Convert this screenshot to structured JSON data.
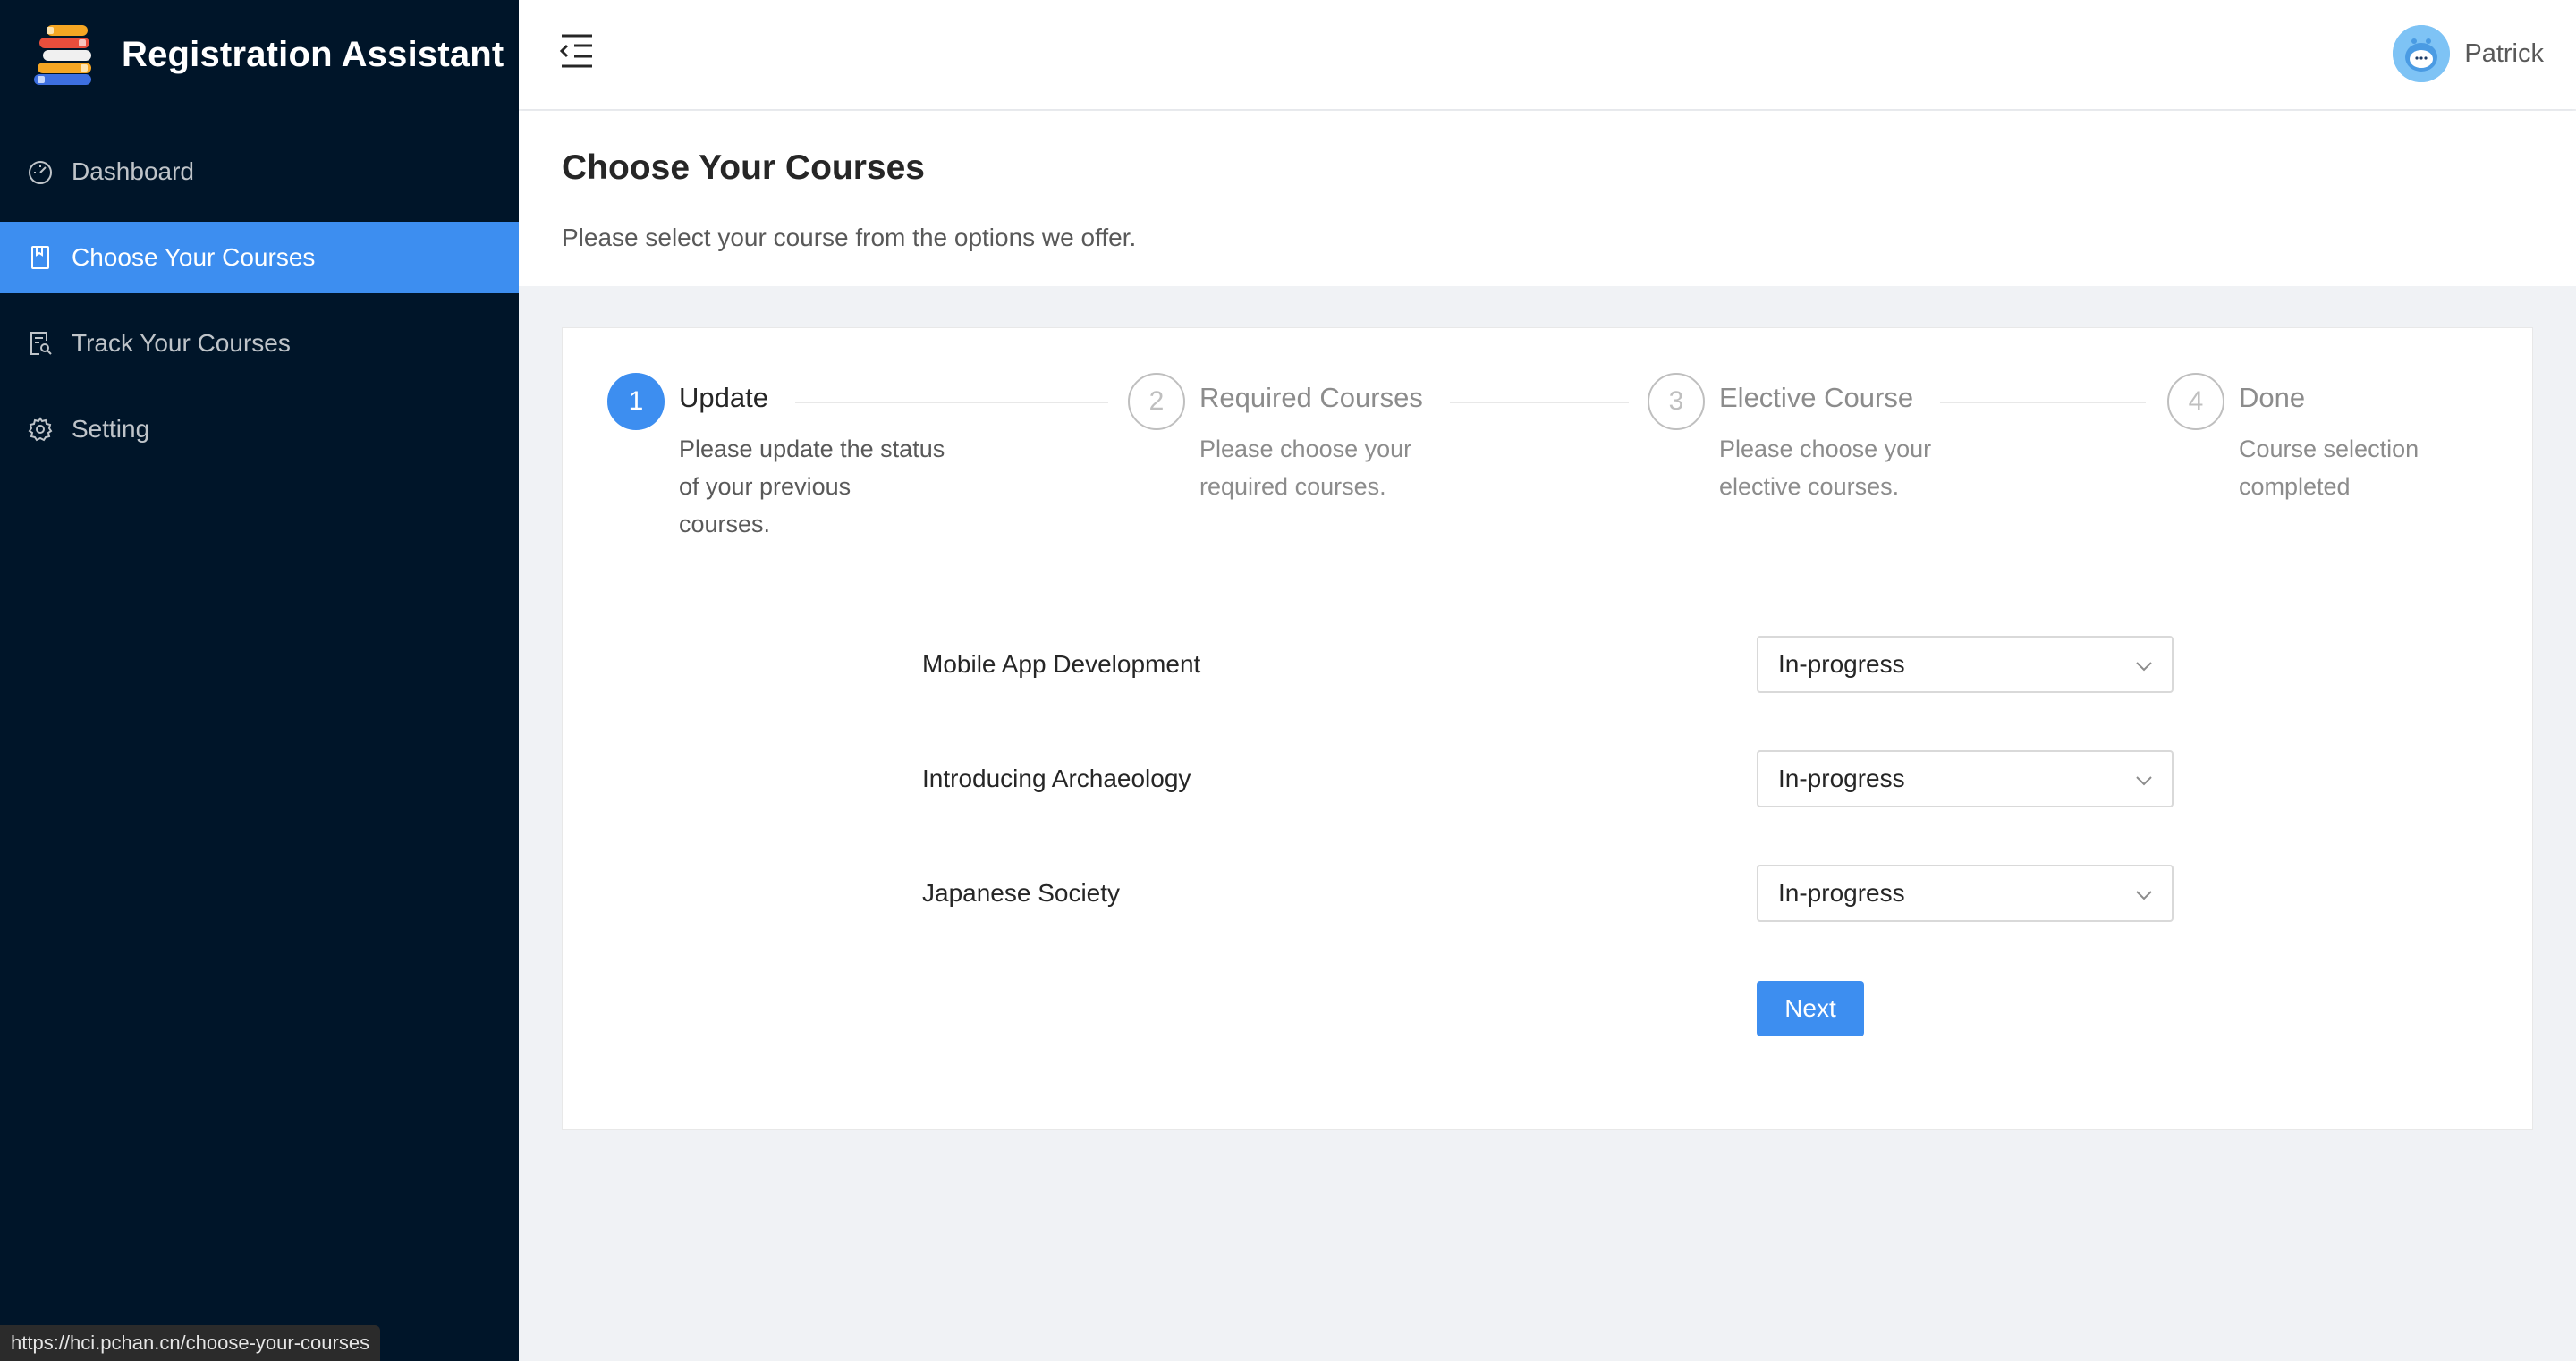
{
  "app": {
    "title": "Registration Assistant",
    "accent_color": "#3d8ef0",
    "sidebar_color": "#001529"
  },
  "sidebar": {
    "items": [
      {
        "label": "Dashboard",
        "icon": "dashboard-icon",
        "active": false
      },
      {
        "label": "Choose Your Courses",
        "icon": "book-icon",
        "active": true
      },
      {
        "label": "Track Your Courses",
        "icon": "file-search-icon",
        "active": false
      },
      {
        "label": "Setting",
        "icon": "gear-icon",
        "active": false
      }
    ]
  },
  "header": {
    "collapse_icon": "menu-fold-icon",
    "user_name": "Patrick",
    "avatar_icon": "avatar-icon"
  },
  "page": {
    "title": "Choose Your Courses",
    "subtitle": "Please select your course from the options we offer."
  },
  "steps": [
    {
      "number": "1",
      "title": "Update",
      "description": "Please update the status of your previous courses.",
      "status": "active"
    },
    {
      "number": "2",
      "title": "Required Courses",
      "description": "Please choose your required courses.",
      "status": "wait"
    },
    {
      "number": "3",
      "title": "Elective Course",
      "description": "Please choose your elective courses.",
      "status": "wait"
    },
    {
      "number": "4",
      "title": "Done",
      "description": "Course selection completed",
      "status": "wait"
    }
  ],
  "courses": [
    {
      "name": "Mobile App Development",
      "status": "In-progress"
    },
    {
      "name": "Introducing Archaeology",
      "status": "In-progress"
    },
    {
      "name": "Japanese Society",
      "status": "In-progress"
    }
  ],
  "actions": {
    "next_label": "Next"
  },
  "status_bar": {
    "url": "https://hci.pchan.cn/choose-your-courses"
  }
}
